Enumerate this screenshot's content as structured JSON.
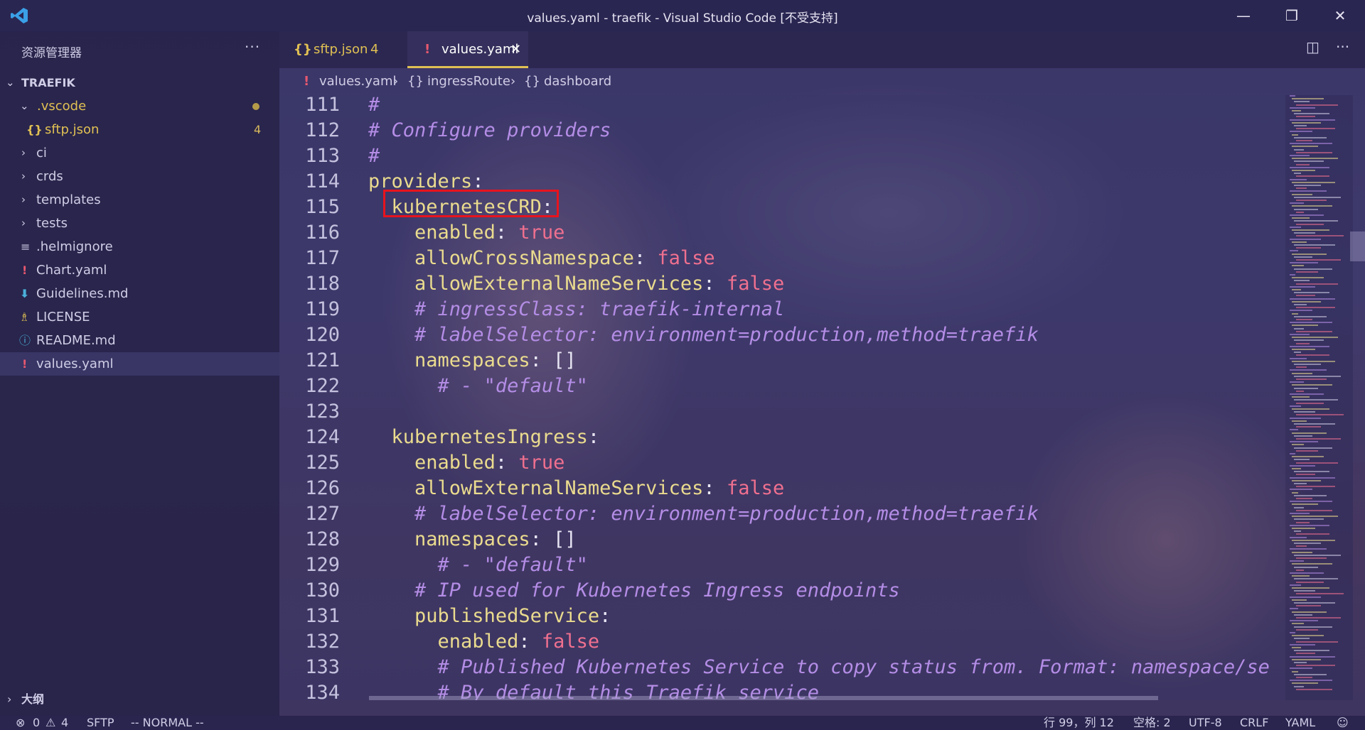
{
  "window": {
    "title": "values.yaml - traefik - Visual Studio Code [不受支持]"
  },
  "sidebar": {
    "header": "资源管理器",
    "root": "TRAEFIK",
    "items": [
      {
        "label": ".vscode",
        "type": "folder-open",
        "color": "#e0c053"
      },
      {
        "label": "sftp.json",
        "type": "json",
        "badge": "4",
        "color": "#e0c053"
      },
      {
        "label": "ci",
        "type": "folder"
      },
      {
        "label": "crds",
        "type": "folder"
      },
      {
        "label": "templates",
        "type": "folder"
      },
      {
        "label": "tests",
        "type": "folder"
      },
      {
        "label": ".helmignore",
        "type": "lines"
      },
      {
        "label": "Chart.yaml",
        "type": "yaml"
      },
      {
        "label": "Guidelines.md",
        "type": "markdown"
      },
      {
        "label": "LICENSE",
        "type": "license"
      },
      {
        "label": "README.md",
        "type": "info"
      },
      {
        "label": "values.yaml",
        "type": "yaml",
        "selected": true
      }
    ],
    "outline": "大纲"
  },
  "tabs": [
    {
      "icon": "{}",
      "label": "sftp.json",
      "badge": "4",
      "active": false
    },
    {
      "icon": "!",
      "label": "values.yaml",
      "close": "✕",
      "active": true
    }
  ],
  "breadcrumb": {
    "file_icon": "!",
    "file": "values.yaml",
    "sep": "›",
    "obj_icon": "{}",
    "seg1": "ingressRoute",
    "seg2": "dashboard"
  },
  "editor": {
    "lines": [
      {
        "n": "111",
        "tokens": [
          {
            "t": "#",
            "c": "c"
          }
        ]
      },
      {
        "n": "112",
        "tokens": [
          {
            "t": "# Configure providers",
            "c": "c"
          }
        ]
      },
      {
        "n": "113",
        "tokens": [
          {
            "t": "#",
            "c": "c"
          }
        ]
      },
      {
        "n": "114",
        "tokens": [
          {
            "t": "providers",
            "c": "k"
          },
          {
            "t": ":",
            "c": "p"
          }
        ]
      },
      {
        "n": "115",
        "tokens": [
          {
            "t": "  "
          },
          {
            "t": "kubernetesCRD",
            "c": "k"
          },
          {
            "t": ":",
            "c": "p"
          }
        ]
      },
      {
        "n": "116",
        "tokens": [
          {
            "t": "    "
          },
          {
            "t": "enabled",
            "c": "k"
          },
          {
            "t": ": ",
            "c": "p"
          },
          {
            "t": "true",
            "c": "t"
          }
        ]
      },
      {
        "n": "117",
        "tokens": [
          {
            "t": "    "
          },
          {
            "t": "allowCrossNamespace",
            "c": "k"
          },
          {
            "t": ": ",
            "c": "p"
          },
          {
            "t": "false",
            "c": "t"
          }
        ]
      },
      {
        "n": "118",
        "tokens": [
          {
            "t": "    "
          },
          {
            "t": "allowExternalNameServices",
            "c": "k"
          },
          {
            "t": ": ",
            "c": "p"
          },
          {
            "t": "false",
            "c": "t"
          }
        ]
      },
      {
        "n": "119",
        "tokens": [
          {
            "t": "    "
          },
          {
            "t": "# ingressClass: traefik-internal",
            "c": "c"
          }
        ]
      },
      {
        "n": "120",
        "tokens": [
          {
            "t": "    "
          },
          {
            "t": "# labelSelector: environment=production,method=traefik",
            "c": "c"
          }
        ]
      },
      {
        "n": "121",
        "tokens": [
          {
            "t": "    "
          },
          {
            "t": "namespaces",
            "c": "k"
          },
          {
            "t": ": []",
            "c": "p"
          }
        ]
      },
      {
        "n": "122",
        "tokens": [
          {
            "t": "      "
          },
          {
            "t": "# - \"default\"",
            "c": "c"
          }
        ]
      },
      {
        "n": "123",
        "tokens": []
      },
      {
        "n": "124",
        "tokens": [
          {
            "t": "  "
          },
          {
            "t": "kubernetesIngress",
            "c": "k"
          },
          {
            "t": ":",
            "c": "p"
          }
        ]
      },
      {
        "n": "125",
        "tokens": [
          {
            "t": "    "
          },
          {
            "t": "enabled",
            "c": "k"
          },
          {
            "t": ": ",
            "c": "p"
          },
          {
            "t": "true",
            "c": "t"
          }
        ]
      },
      {
        "n": "126",
        "tokens": [
          {
            "t": "    "
          },
          {
            "t": "allowExternalNameServices",
            "c": "k"
          },
          {
            "t": ": ",
            "c": "p"
          },
          {
            "t": "false",
            "c": "t"
          }
        ]
      },
      {
        "n": "127",
        "tokens": [
          {
            "t": "    "
          },
          {
            "t": "# labelSelector: environment=production,method=traefik",
            "c": "c"
          }
        ]
      },
      {
        "n": "128",
        "tokens": [
          {
            "t": "    "
          },
          {
            "t": "namespaces",
            "c": "k"
          },
          {
            "t": ": []",
            "c": "p"
          }
        ]
      },
      {
        "n": "129",
        "tokens": [
          {
            "t": "      "
          },
          {
            "t": "# - \"default\"",
            "c": "c"
          }
        ]
      },
      {
        "n": "130",
        "tokens": [
          {
            "t": "    "
          },
          {
            "t": "# IP used for Kubernetes Ingress endpoints",
            "c": "c"
          }
        ]
      },
      {
        "n": "131",
        "tokens": [
          {
            "t": "    "
          },
          {
            "t": "publishedService",
            "c": "k"
          },
          {
            "t": ":",
            "c": "p"
          }
        ]
      },
      {
        "n": "132",
        "tokens": [
          {
            "t": "      "
          },
          {
            "t": "enabled",
            "c": "k"
          },
          {
            "t": ": ",
            "c": "p"
          },
          {
            "t": "false",
            "c": "t"
          }
        ]
      },
      {
        "n": "133",
        "tokens": [
          {
            "t": "      "
          },
          {
            "t": "# Published Kubernetes Service to copy status from. Format: namespace/se",
            "c": "c"
          }
        ]
      },
      {
        "n": "134",
        "tokens": [
          {
            "t": "      "
          },
          {
            "t": "# By default this Traefik service",
            "c": "c"
          }
        ]
      }
    ],
    "highlight_line": "115",
    "highlight_color": "#e8131d"
  },
  "statusbar": {
    "errors": "0",
    "warnings": "4",
    "sftp": "SFTP",
    "mode": "-- NORMAL --",
    "position": "行 99，列 12",
    "indent": "空格: 2",
    "encoding": "UTF-8",
    "eol": "CRLF",
    "language": "YAML"
  }
}
